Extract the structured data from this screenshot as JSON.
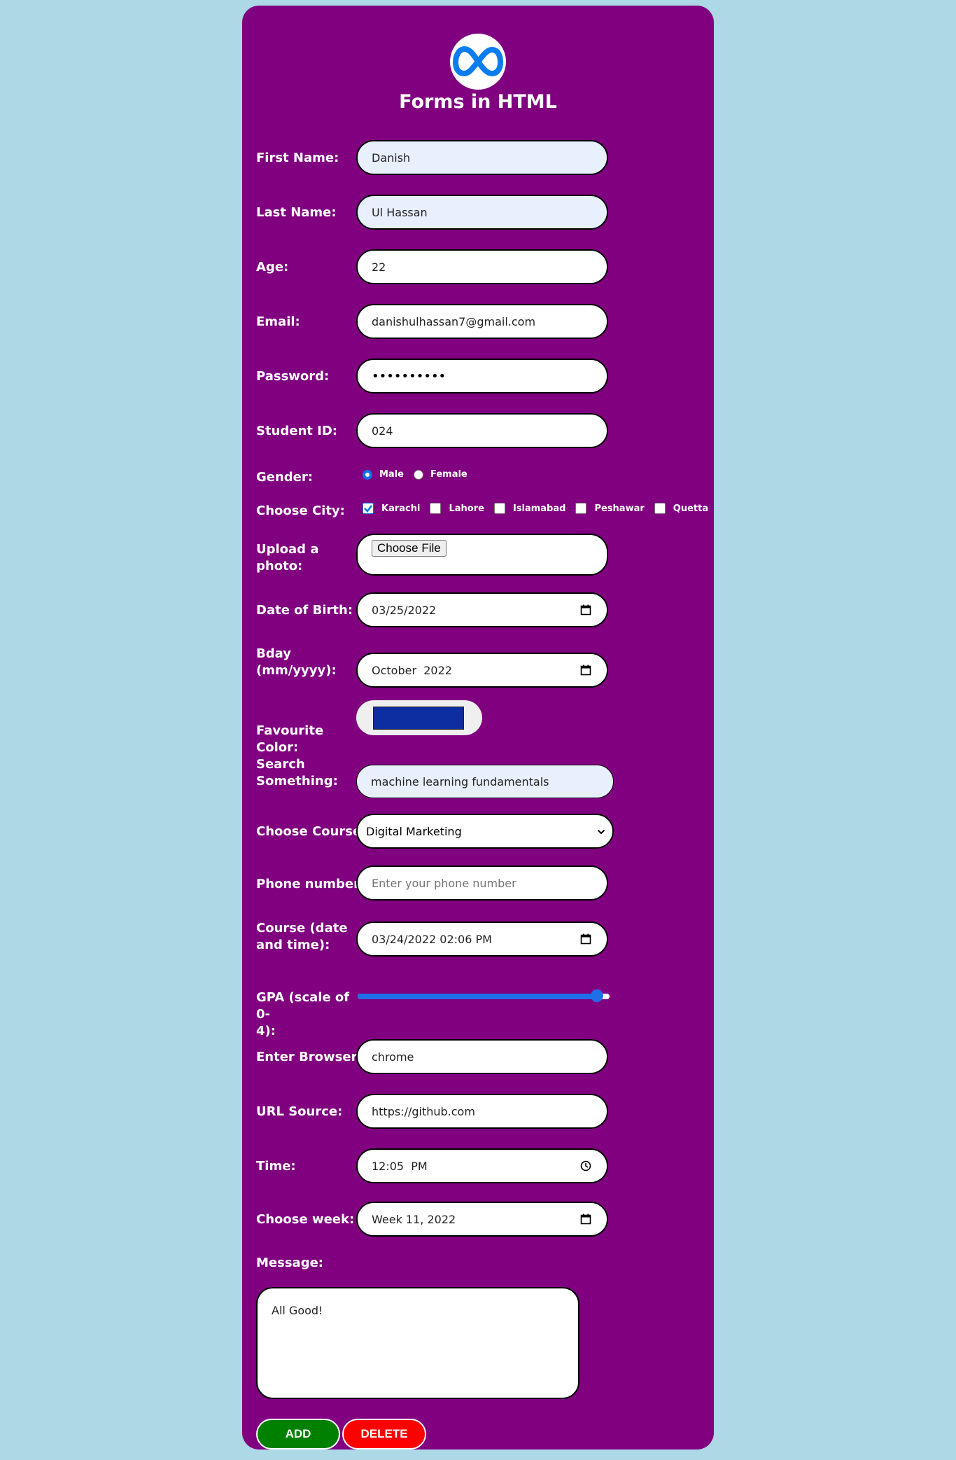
{
  "title": "Forms in HTML",
  "fields": {
    "first_name": {
      "label": "First Name:",
      "value": "Danish"
    },
    "last_name": {
      "label": "Last Name:",
      "value": "Ul Hassan"
    },
    "age": {
      "label": "Age:",
      "value": "22"
    },
    "email": {
      "label": "Email:",
      "value": "danishulhassan7@gmail.com"
    },
    "password": {
      "label": "Password:",
      "value": "••••••••••"
    },
    "student_id": {
      "label": "Student ID:",
      "value": "024"
    },
    "gender": {
      "label": "Gender:",
      "options": [
        "Male",
        "Female"
      ],
      "selected": "Male"
    },
    "city": {
      "label": "Choose City:",
      "options": [
        "Karachi",
        "Lahore",
        "Islamabad",
        "Peshawar",
        "Quetta"
      ],
      "checked": [
        "Karachi"
      ]
    },
    "photo": {
      "label": "Upload a photo:",
      "button": "Choose File"
    },
    "dob": {
      "label": "Date of Birth:",
      "value": "03/25/2022"
    },
    "bday": {
      "label_line1": "Bday",
      "label_line2": "(mm/yyyy):",
      "value": "October  2022"
    },
    "favourite_color": {
      "label": "Favourite Color:",
      "value": "#0d2ea0"
    },
    "search": {
      "label_line1": "Search",
      "label_line2": "Something:",
      "value": "machine learning fundamentals"
    },
    "course": {
      "label": "Choose Course:",
      "value": "Digital Marketing"
    },
    "phone": {
      "label": "Phone number:",
      "placeholder": "Enter your phone number"
    },
    "course_datetime": {
      "label_line1": "Course (date",
      "label_line2": "and time):",
      "value": "03/24/2022 02:06 PM"
    },
    "gpa": {
      "label_line1": "GPA (scale of 0-",
      "label_line2": "4):",
      "value": 3.8,
      "max": 4
    },
    "browser": {
      "label": "Enter Browser:",
      "value": "chrome"
    },
    "url": {
      "label": "URL Source:",
      "value": "https://github.com"
    },
    "time": {
      "label": "Time:",
      "value": "12:05  PM"
    },
    "week": {
      "label": "Choose week:",
      "value": "Week 11, 2022"
    },
    "message": {
      "label": "Message:",
      "value": "All Good!"
    }
  },
  "buttons": {
    "add": "ADD",
    "delete": "DELETE"
  },
  "colors": {
    "page_bg": "#add8e6",
    "card_bg": "#800080",
    "add_button": "#008000",
    "delete_button": "#ff0000"
  }
}
